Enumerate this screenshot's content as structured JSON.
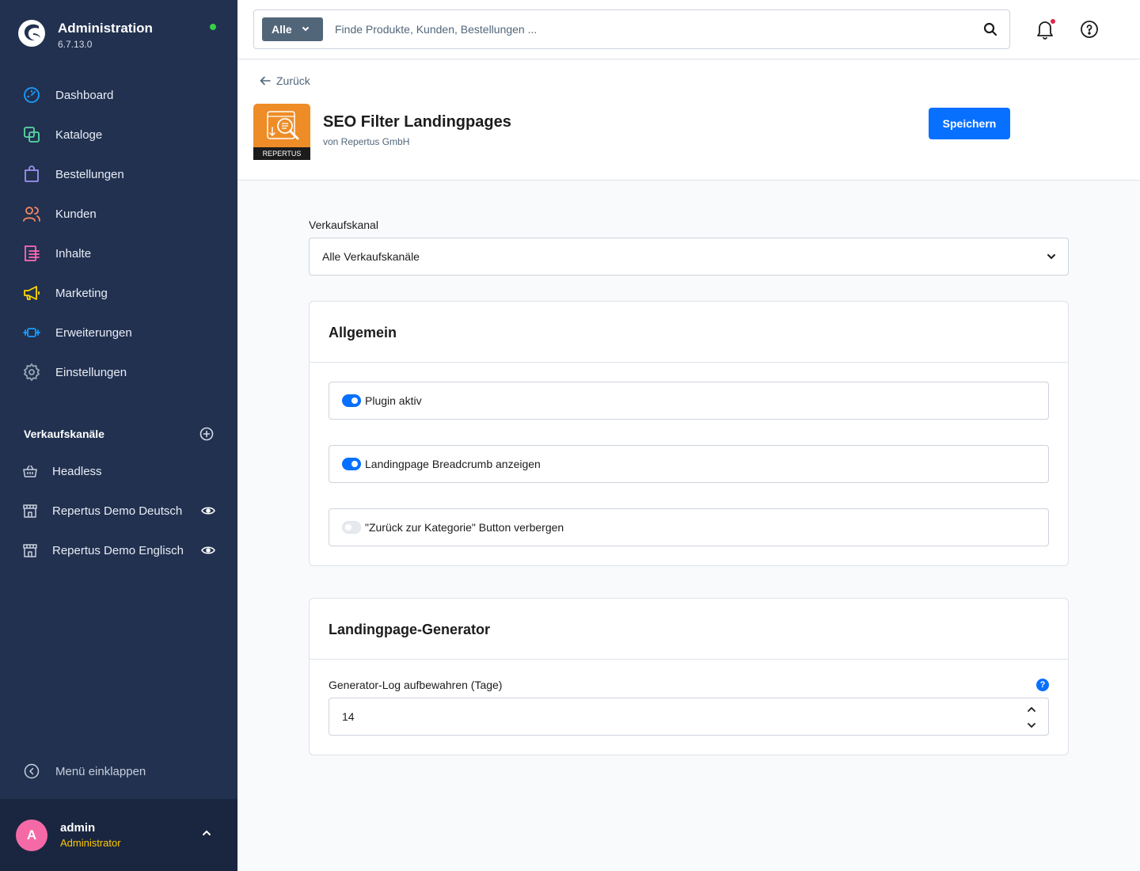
{
  "app": {
    "title": "Administration",
    "version": "6.7.13.0",
    "status_color": "#37d046"
  },
  "nav": {
    "items": [
      {
        "label": "Dashboard",
        "icon": "dashboard-gauge-icon",
        "color": "#189eff"
      },
      {
        "label": "Kataloge",
        "icon": "catalog-icon",
        "color": "#57d9a3"
      },
      {
        "label": "Bestellungen",
        "icon": "shopping-bag-icon",
        "color": "#a092f0"
      },
      {
        "label": "Kunden",
        "icon": "users-icon",
        "color": "#f88962"
      },
      {
        "label": "Inhalte",
        "icon": "content-icon",
        "color": "#ff68b4"
      },
      {
        "label": "Marketing",
        "icon": "megaphone-icon",
        "color": "#ffd700"
      },
      {
        "label": "Erweiterungen",
        "icon": "plug-icon",
        "color": "#189eff"
      },
      {
        "label": "Einstellungen",
        "icon": "gear-icon",
        "color": "#9aa8b5"
      }
    ]
  },
  "sales_channels": {
    "title": "Verkaufskanäle",
    "items": [
      {
        "label": "Headless",
        "icon": "basket-icon",
        "has_eye": false
      },
      {
        "label": "Repertus Demo Deutsch",
        "icon": "storefront-icon",
        "has_eye": true
      },
      {
        "label": "Repertus Demo Englisch",
        "icon": "storefront-icon",
        "has_eye": true
      }
    ]
  },
  "collapse_label": "Menü einklappen",
  "user": {
    "initial": "A",
    "name": "admin",
    "role": "Administrator"
  },
  "search": {
    "type_label": "Alle",
    "placeholder": "Finde Produkte, Kunden, Bestellungen ..."
  },
  "header": {
    "back_label": "Zurück",
    "plugin_title": "SEO Filter Landingpages",
    "plugin_author": "von Repertus GmbH",
    "plugin_icon_text": "REPERTUS",
    "save_label": "Speichern"
  },
  "sales_channel_select": {
    "label": "Verkaufskanal",
    "value": "Alle Verkaufskanäle"
  },
  "general_card": {
    "title": "Allgemein",
    "toggles": [
      {
        "label": "Plugin aktiv",
        "checked": true
      },
      {
        "label": "Landingpage Breadcrumb anzeigen",
        "checked": true
      },
      {
        "label": "\"Zurück zur Kategorie\" Button verbergen",
        "checked": false
      }
    ]
  },
  "generator_card": {
    "title": "Landingpage-Generator",
    "field_label": "Generator-Log aufbewahren (Tage)",
    "field_value": "14",
    "help_symbol": "?"
  }
}
